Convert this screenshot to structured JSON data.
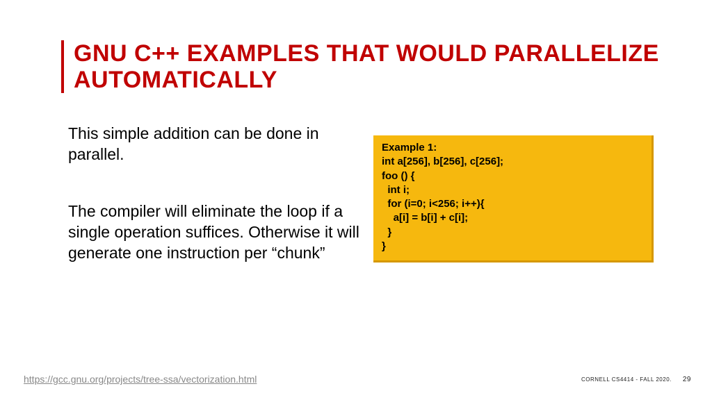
{
  "title": "GNU C++ EXAMPLES THAT WOULD PARALLELIZE AUTOMATICALLY",
  "paragraphs": [
    "This simple addition can be done in parallel.",
    "The compiler will eliminate the loop if a single operation suffices. Otherwise it will generate one instruction per “chunk”"
  ],
  "code": {
    "lines": [
      "Example 1:",
      "int a[256], b[256], c[256];",
      "foo () {",
      "  int i;",
      "",
      "  for (i=0; i<256; i++){",
      "    a[i] = b[i] + c[i];",
      "  }",
      "}"
    ]
  },
  "footer": {
    "link": "https://gcc.gnu.org/projects/tree-ssa/vectorization.html",
    "course": "CORNELL CS4414 - FALL 2020.",
    "page": "29"
  }
}
